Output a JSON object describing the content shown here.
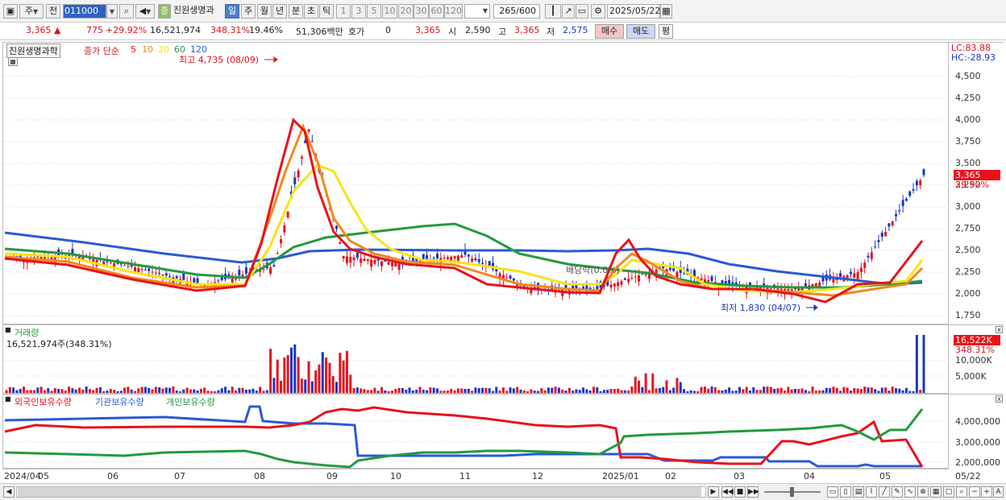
{
  "toolbar": {
    "market_type": "주",
    "prev_label": "전",
    "stock_code": "011000",
    "stock_name": "진원생명과",
    "jeung_label": "증",
    "periods": [
      "일",
      "주",
      "월",
      "년",
      "분",
      "초",
      "틱"
    ],
    "selected_period": "일",
    "intervals": [
      "1",
      "3",
      "5",
      "10",
      "20",
      "30",
      "60",
      "120"
    ],
    "count_value": "265",
    "count_total": "/600",
    "date": "2025/05/22"
  },
  "quote": {
    "price": "3,365",
    "change": "775",
    "change_pct": "+29.92%",
    "volume": "16,521,974",
    "volume_ratio": "348.31%",
    "turnover": "19.46%",
    "amount": "51,306백만",
    "hoga_label": "호가",
    "hoga_value": "0",
    "hoga_price": "3,365",
    "open_label": "시",
    "open_value": "2,590",
    "high_label": "고",
    "high_value": "3,365",
    "low_label": "저",
    "low_value": "2,575",
    "buy_label": "매수",
    "sell_label": "매도",
    "eval_label": "평"
  },
  "price_panel": {
    "stock_label": "진원생명과학",
    "ma_label": "종가 단순",
    "ma_periods": [
      "5",
      "10",
      "20",
      "60",
      "120"
    ],
    "ma_colors": [
      "#e8121c",
      "#f08a1a",
      "#f7e41a",
      "#229a40",
      "#2a5ad6"
    ],
    "high_annotation": "최고 4,735 (08/09)",
    "low_annotation": "최저 1,830 (04/07)",
    "dividend_annotation": "배당락(0.0%)",
    "lc": "LC:83.88",
    "hc": "HC:-28.93",
    "price_ticks": [
      "4,500",
      "4,250",
      "4,000",
      "3,750",
      "3,500",
      "3,250",
      "3,000",
      "2,750",
      "2,500",
      "2,250",
      "2,000",
      "1,750"
    ],
    "current_badge": "3,365",
    "current_pct": "29.92%"
  },
  "volume_panel": {
    "title": "거래량",
    "value_text": "16,521,974주(348.31%)",
    "badge": "16,522K",
    "badge_pct": "348.31%",
    "ticks": [
      "10,000K",
      "5,000K"
    ]
  },
  "holder_panel": {
    "legend": [
      "외국인보유수량",
      "기관보유수량",
      "개인보유수량"
    ],
    "legend_colors": [
      "#e8121c",
      "#2a5ad6",
      "#229a40"
    ],
    "ticks": [
      "4,000,000",
      "3,000,000",
      "2,000,000"
    ]
  },
  "xaxis": {
    "labels": [
      "2024/04",
      "05",
      "06",
      "07",
      "08",
      "09",
      "10",
      "11",
      "12",
      "2025/01",
      "02",
      "03",
      "04",
      "05",
      "05/22"
    ]
  },
  "chart_data": {
    "type": "line",
    "title": "진원생명과학 일봉",
    "x": [
      "2024/04",
      "2024/05",
      "2024/06",
      "2024/07",
      "2024/08",
      "2024/09",
      "2024/10",
      "2024/11",
      "2024/12",
      "2025/01",
      "2025/02",
      "2025/03",
      "2025/04",
      "2025/05",
      "2025/05/22"
    ],
    "series": [
      {
        "name": "종가",
        "values": [
          2400,
          2450,
          2300,
          2100,
          2300,
          2450,
          2350,
          2450,
          2050,
          2050,
          2300,
          2100,
          2050,
          2250,
          3365
        ]
      },
      {
        "name": "외국인보유수량",
        "values": [
          3900000,
          3800000,
          3700000,
          3700000,
          3700000,
          4700000,
          4400000,
          4200000,
          3800000,
          3900000,
          2100000,
          2000000,
          3200000,
          4100000,
          2000000
        ]
      },
      {
        "name": "기관보유수량",
        "values": [
          4200000,
          4200000,
          4200000,
          4300000,
          4600000,
          4000000,
          2300000,
          2300000,
          2300000,
          2400000,
          2000000,
          2200000,
          1900000,
          1900000,
          1900000
        ]
      },
      {
        "name": "개인보유수량",
        "values": [
          2400000,
          2400000,
          2400000,
          2500000,
          2400000,
          1900000,
          2300000,
          2500000,
          2500000,
          2400000,
          3400000,
          3600000,
          3700000,
          3700000,
          4700000
        ]
      }
    ],
    "price_ylim": [
      1750,
      4750
    ],
    "high": 4735,
    "low": 1830,
    "grid": true,
    "legend": "top-left"
  }
}
